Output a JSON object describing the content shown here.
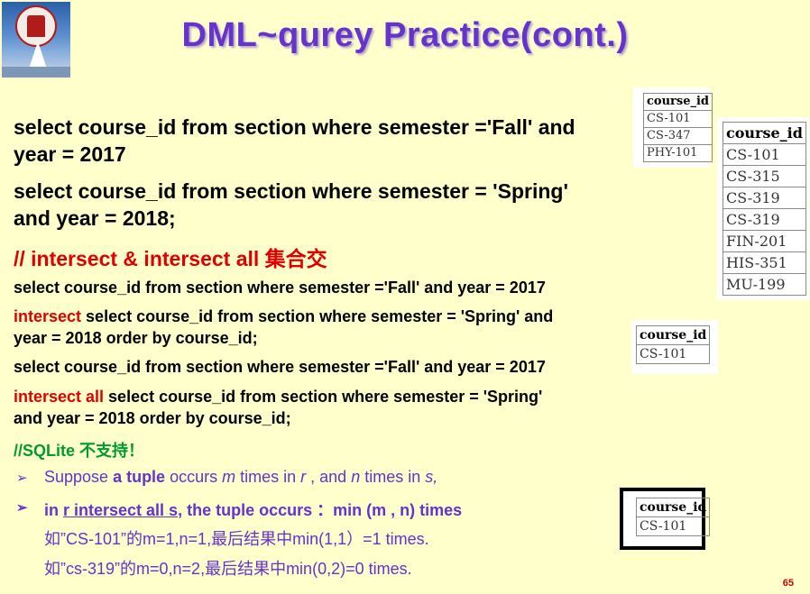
{
  "title": "DML~qurey  Practice(cont.)",
  "query1": {
    "line1": "select course_id from section where semester ='Fall' and",
    "line2": "year = 2017"
  },
  "query2": {
    "line1": "select course_id from section where semester = 'Spring'",
    "line2": "and year = 2018;"
  },
  "section_heading": "// intersect & intersect all 集合交",
  "ex1": {
    "line1": "select course_id from section where semester ='Fall' and year = 2017",
    "keyword": "intersect",
    "line2_rest": " select course_id from section where semester = 'Spring' and",
    "line3": "year = 2018  order by course_id;"
  },
  "ex2": {
    "line1": "select course_id from section where semester ='Fall' and year = 2017",
    "keyword": "intersect all",
    "line2_rest": "  select course_id from section where semester = 'Spring'",
    "line3": "and year = 2018 order by course_id;"
  },
  "sqlite_note": "//SQLite 不支持！",
  "bullet1": {
    "p1": "Suppose ",
    "p2": "a tuple",
    "p3": " occurs ",
    "p4": "m",
    "p5": " times in ",
    "p6": "r",
    "p7": " , and ",
    "p8": "n",
    "p9": " times in ",
    "p10": "s,"
  },
  "bullet2": {
    "p1": "in  ",
    "p2": "r intersect all s",
    "p3": ", the tuple occurs ：min (m , n) times"
  },
  "example1": "如”CS-101”的m=1,n=1,最后结果中min(1,1）=1 times.",
  "example2": "如”cs-319”的m=0,n=2,最后结果中min(0,2)=0 times.",
  "table_fall": {
    "header": "course_id",
    "rows": [
      "CS-101",
      "CS-347",
      "PHY-101"
    ]
  },
  "table_spring": {
    "header": "course_id",
    "rows": [
      "CS-101",
      "CS-315",
      "CS-319",
      "CS-319",
      "FIN-201",
      "HIS-351",
      "MU-199"
    ]
  },
  "table_intersect": {
    "header": "course_id",
    "rows": [
      "CS-101"
    ]
  },
  "table_intersect_all": {
    "header": "course_id",
    "rows": [
      "CS-101"
    ]
  },
  "page_number": "65",
  "colors": {
    "background": "#ffffcc",
    "title": "#6633cc",
    "keyword": "#e00000",
    "note": "#009933"
  }
}
